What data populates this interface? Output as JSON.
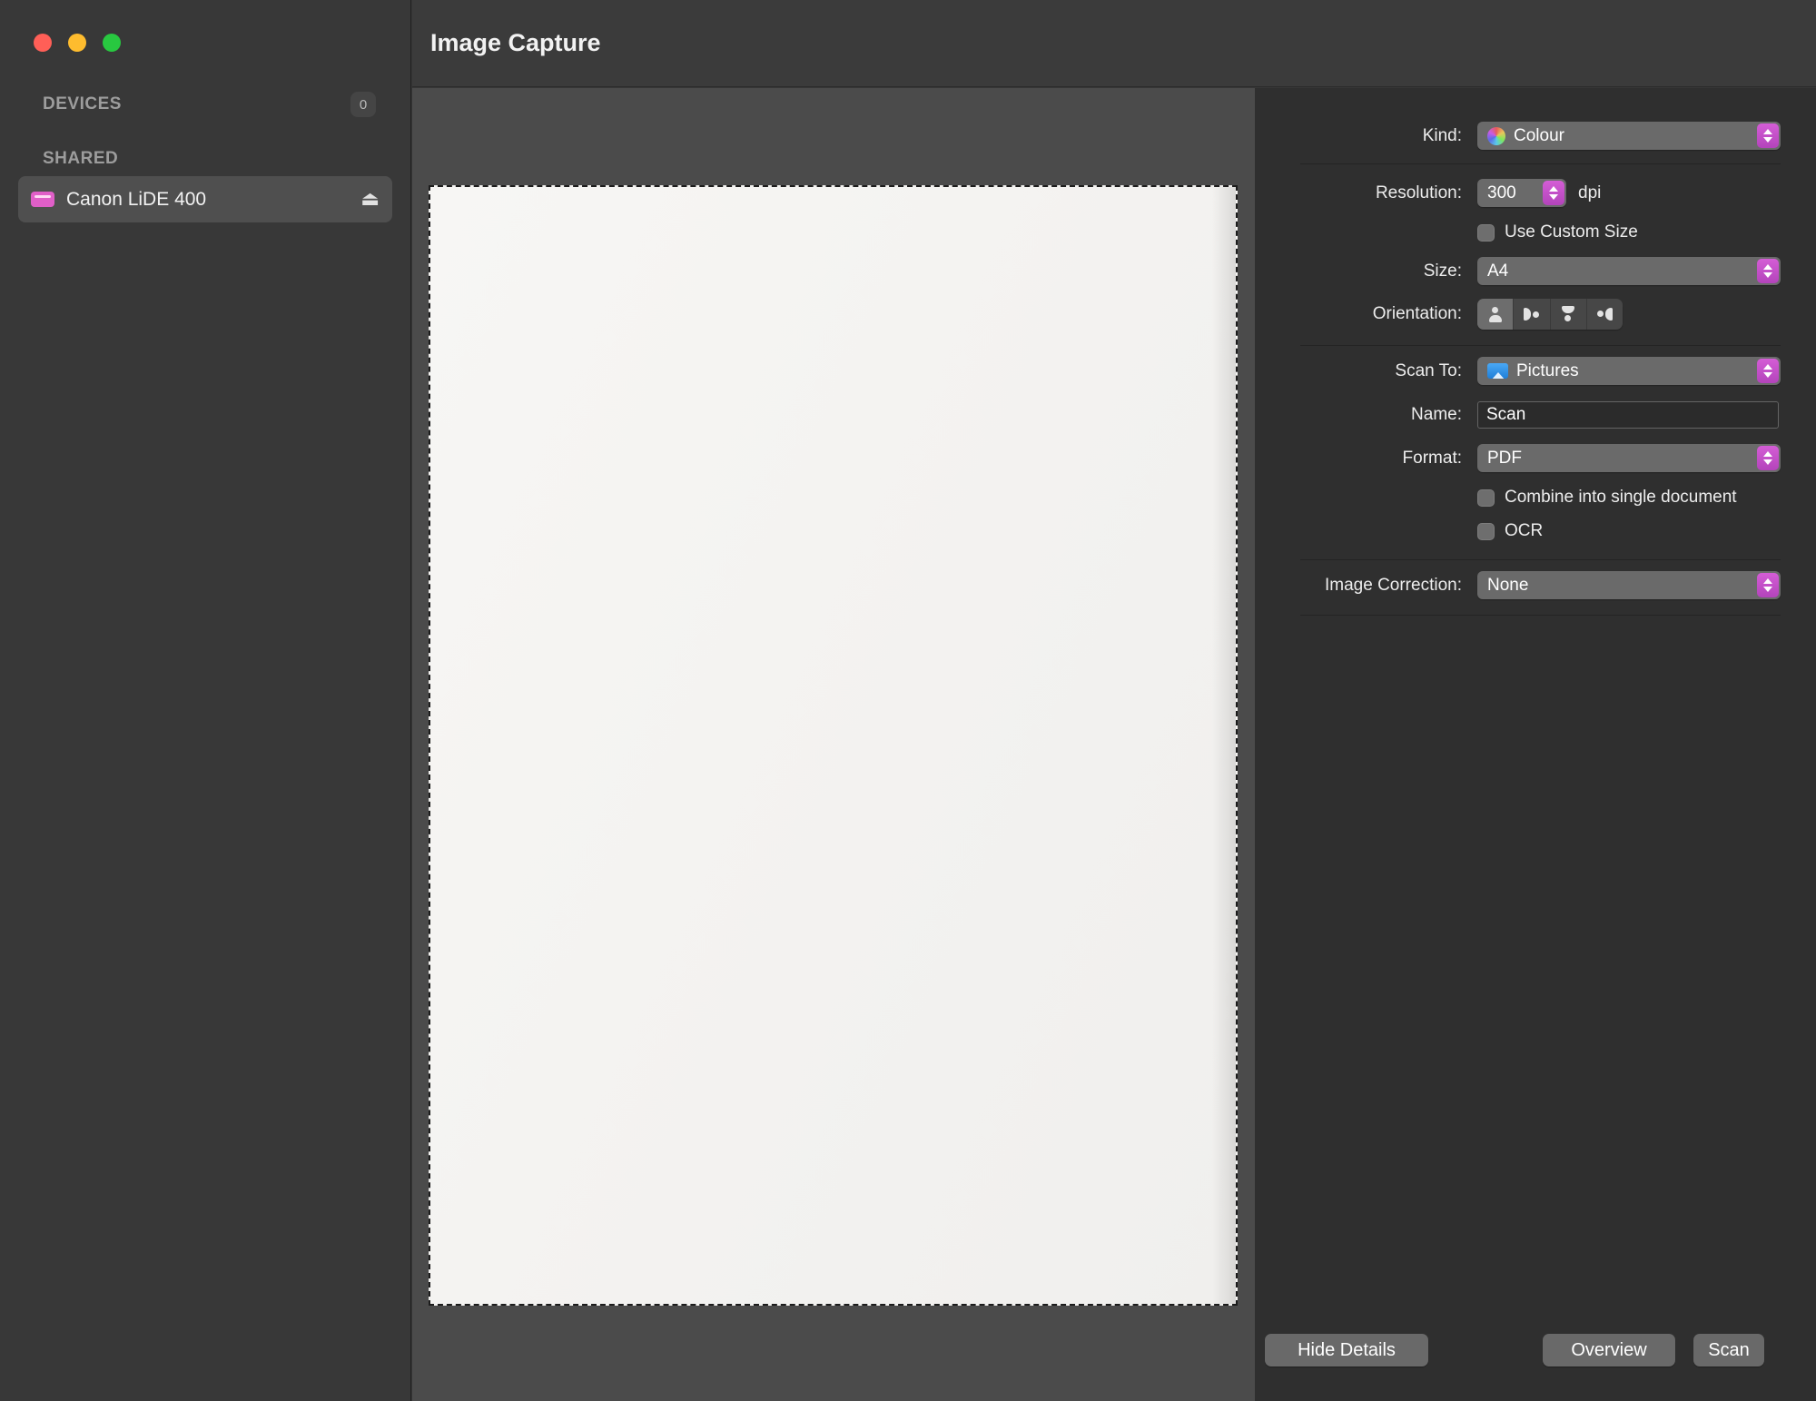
{
  "window": {
    "title": "Image Capture"
  },
  "sidebar": {
    "devices_header": "DEVICES",
    "devices_count": "0",
    "shared_header": "SHARED",
    "device": {
      "name": "Canon LiDE 400"
    }
  },
  "panel": {
    "kind_label": "Kind:",
    "kind_value": "Colour",
    "resolution_label": "Resolution:",
    "resolution_value": "300",
    "resolution_unit": "dpi",
    "use_custom_size_label": "Use Custom Size",
    "use_custom_size_checked": false,
    "size_label": "Size:",
    "size_value": "A4",
    "orientation_label": "Orientation:",
    "scan_to_label": "Scan To:",
    "scan_to_value": "Pictures",
    "name_label": "Name:",
    "name_value": "Scan",
    "format_label": "Format:",
    "format_value": "PDF",
    "combine_label": "Combine into single document",
    "combine_checked": false,
    "ocr_label": "OCR",
    "ocr_checked": false,
    "image_correction_label": "Image Correction:",
    "image_correction_value": "None"
  },
  "footer": {
    "hide_details": "Hide Details",
    "overview": "Overview",
    "scan": "Scan"
  },
  "colors": {
    "accent": "#c24fc9",
    "titlebar": "#3b3b3b",
    "sidebar": "#383838",
    "preview": "#4b4b4b",
    "panel": "#2f2f2f"
  }
}
